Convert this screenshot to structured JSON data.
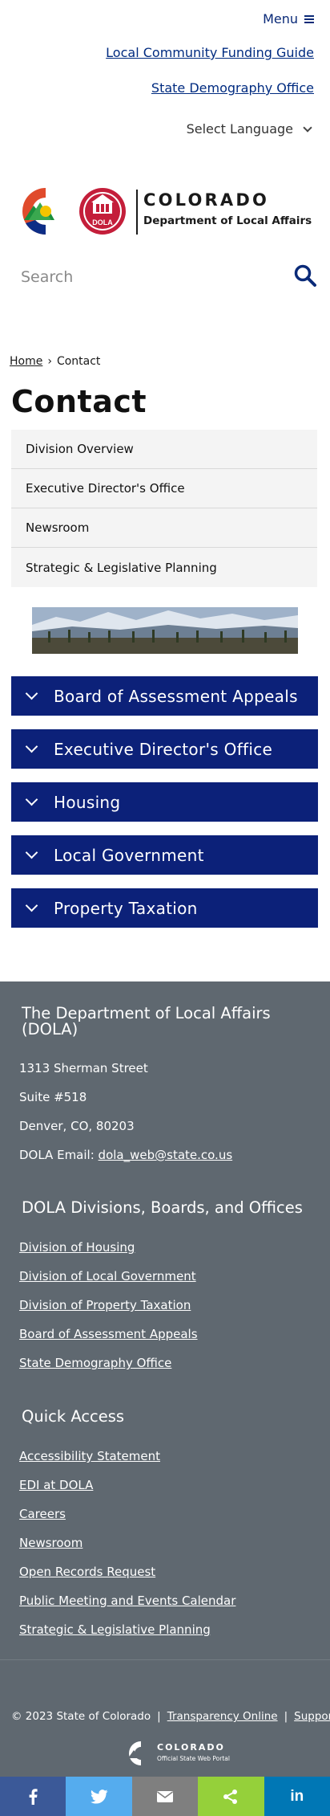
{
  "header": {
    "menu_label": "Menu",
    "links": [
      "Local Community Funding Guide",
      "State Demography Office"
    ],
    "language_label": "Select Language"
  },
  "logo": {
    "line1": "COLORADO",
    "line2": "Department of Local Affairs",
    "badge": "DOLA"
  },
  "search": {
    "placeholder": "Search"
  },
  "breadcrumb": {
    "home": "Home",
    "separator": "›",
    "current": "Contact"
  },
  "page_title": "Contact",
  "subnav": [
    "Division Overview",
    "Executive Director's Office",
    "Newsroom",
    "Strategic & Legislative Planning"
  ],
  "accordions": [
    "Board of Assessment Appeals",
    "Executive Director's Office",
    "Housing",
    "Local Government",
    "Property Taxation"
  ],
  "footer": {
    "org_heading": "The Department of Local Affairs (DOLA)",
    "address": [
      "1313 Sherman Street",
      "Suite  #518",
      "Denver, CO, 80203"
    ],
    "email_label": "DOLA Email:",
    "email": "dola_web@state.co.us",
    "divisions_heading": "DOLA Divisions, Boards, and Offices",
    "divisions": [
      "Division of Housing",
      "Division of Local Government",
      "Division of Property Taxation",
      "Board of Assessment Appeals",
      "State Demography Office"
    ],
    "quick_heading": "Quick Access",
    "quick_links": [
      "Accessibility Statement",
      "EDI at DOLA",
      "Careers",
      "Newsroom",
      "Open Records Request",
      "Public Meeting and Events Calendar",
      "Strategic & Legislative Planning"
    ]
  },
  "bottom": {
    "copyright": "© 2023 State of Colorado",
    "transparency": "Transparency Online",
    "support": "Support",
    "portal_line1": "COLORADO",
    "portal_line2": "Official State Web Portal"
  },
  "share_bar": [
    {
      "icon": "facebook-icon",
      "color": "#3b5998"
    },
    {
      "icon": "twitter-icon",
      "color": "#55acee"
    },
    {
      "icon": "email-icon",
      "color": "#7f7f7f"
    },
    {
      "icon": "share-icon",
      "color": "#95d03a"
    },
    {
      "icon": "linkedin-icon",
      "color": "#0077b5"
    }
  ],
  "colors": {
    "navy": "#0c2179",
    "link_blue": "#002b80",
    "footer_gray": "#5f6870"
  }
}
